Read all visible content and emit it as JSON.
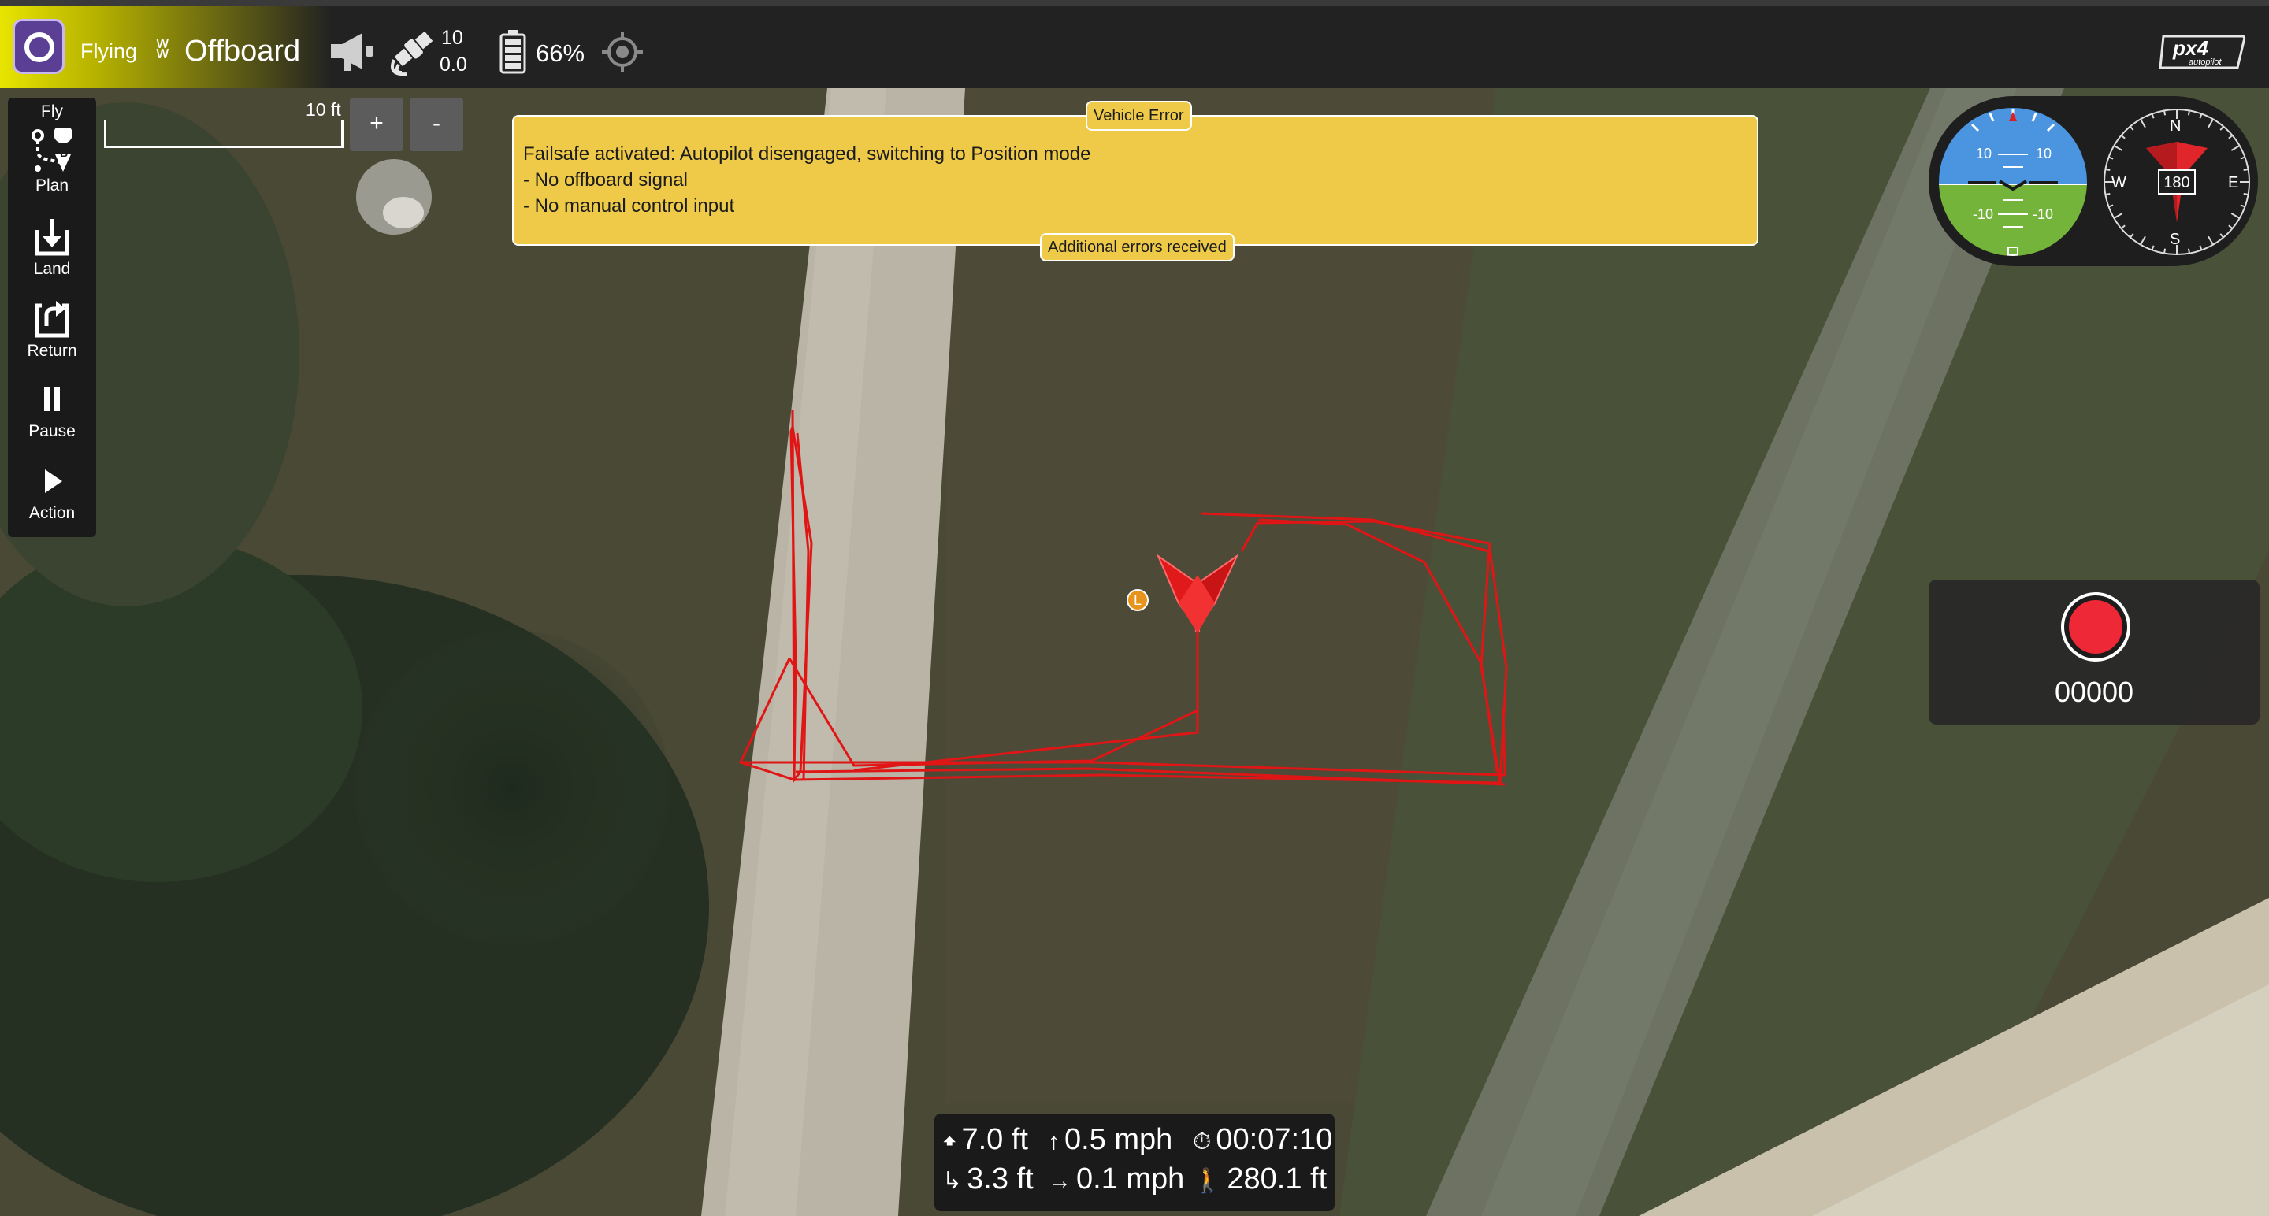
{
  "toolbar": {
    "flight_state": "Flying",
    "flight_mode": "Offboard",
    "mode_icon": "waves-icon",
    "satellite_count": "10",
    "satellite_hdop": "0.0",
    "battery_percent": "66%",
    "brand_logo_text": "px4 autopilot"
  },
  "toolstrip": {
    "items": [
      {
        "label": "Fly",
        "icon": "fly-header"
      },
      {
        "label": "Plan",
        "icon": "plan-icon"
      },
      {
        "label": "Land",
        "icon": "land-icon"
      },
      {
        "label": "Return",
        "icon": "return-icon"
      },
      {
        "label": "Pause",
        "icon": "pause-icon"
      },
      {
        "label": "Action",
        "icon": "play-icon"
      }
    ]
  },
  "map": {
    "scale_label": "10 ft",
    "zoom_in_label": "+",
    "zoom_out_label": "-",
    "launch_marker_label": "L"
  },
  "error": {
    "title": "Vehicle Error",
    "lines": [
      "Failsafe activated: Autopilot disengaged, switching to Position mode",
      "- No offboard signal",
      "- No manual control input"
    ],
    "more_label": "Additional errors received"
  },
  "attitude": {
    "pitch_labels": [
      "10",
      "10",
      "-10",
      "-10"
    ],
    "sky_color": "#4b95e0",
    "ground_color": "#74b43a"
  },
  "compass": {
    "heading": "180",
    "north": "N",
    "south": "S",
    "east": "E",
    "west": "W",
    "arrow_color": "#e0262a"
  },
  "video": {
    "record_time": "00000",
    "record_color": "#ee2836"
  },
  "telemetry": {
    "altitude": "7.0 ft",
    "vertical_speed": "0.5 mph",
    "flight_time": "00:07:10",
    "distance_to_home_alt": "3.3 ft",
    "horizontal_speed": "0.1 mph",
    "distance_to_home": "280.1 ft"
  },
  "colors": {
    "error_bg": "#efca48",
    "path_color": "#e01515",
    "toolbar_bg": "#222222"
  }
}
